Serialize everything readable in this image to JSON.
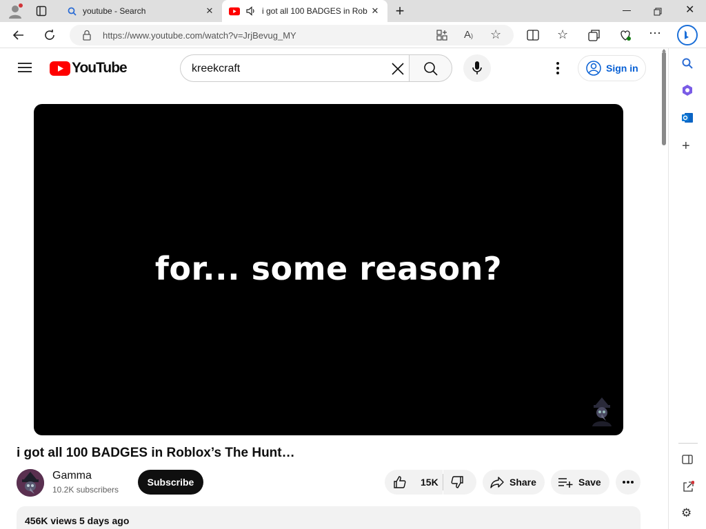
{
  "browser": {
    "tabs": [
      {
        "title": "youtube - Search",
        "active": false,
        "icon": "search-icon"
      },
      {
        "title": "i got all 100 BADGES in Rob",
        "active": true,
        "icon": "youtube-icon"
      }
    ],
    "url": "https://www.youtube.com/watch?v=JrjBevug_MY"
  },
  "youtube": {
    "logo_text": "YouTube",
    "search": {
      "value": "kreekcraft"
    },
    "sign_in_label": "Sign in"
  },
  "video": {
    "overlay_text": "for... some reason?",
    "title": "i got all 100 BADGES in Roblox’s The Hunt…",
    "channel_name": "Gamma",
    "subscribers": "10.2K subscribers",
    "subscribe_label": "Subscribe",
    "likes": "15K",
    "share_label": "Share",
    "save_label": "Save",
    "views": "456K views",
    "date": "5 days ago"
  },
  "colors": {
    "youtube_red": "#ff0000",
    "sign_in_blue": "#065fd4",
    "accent": "#0f0f0f"
  }
}
